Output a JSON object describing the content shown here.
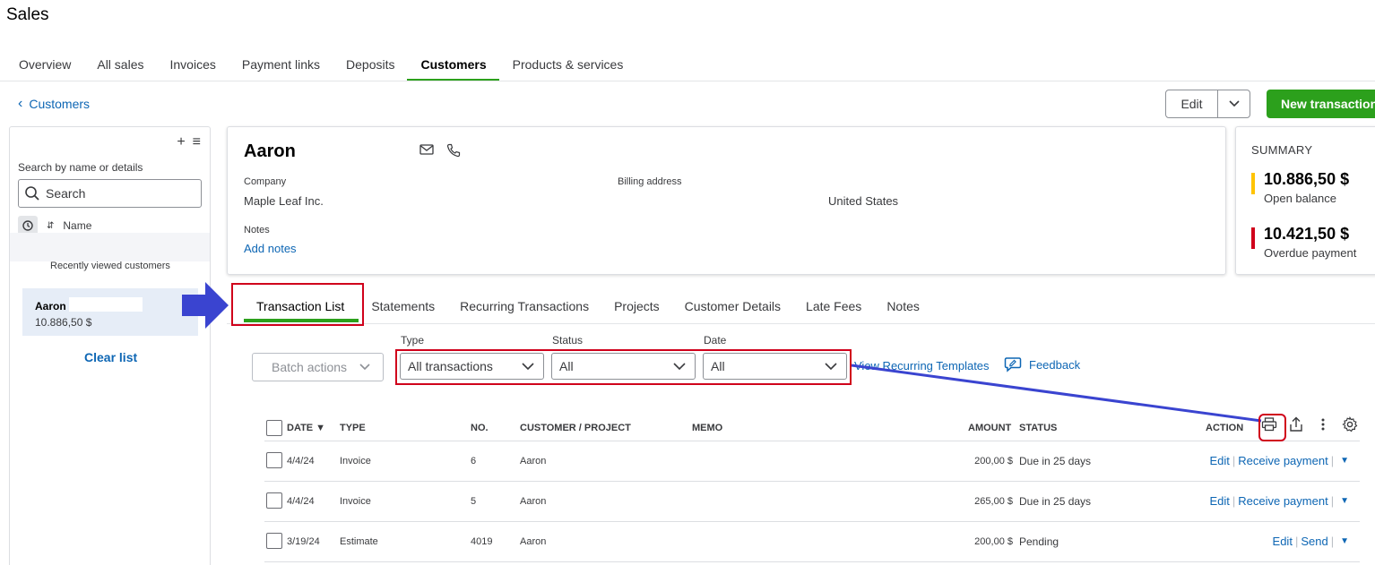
{
  "page": {
    "title": "Sales"
  },
  "top_tabs": [
    {
      "label": "Overview"
    },
    {
      "label": "All sales"
    },
    {
      "label": "Invoices"
    },
    {
      "label": "Payment links"
    },
    {
      "label": "Deposits"
    },
    {
      "label": "Customers"
    },
    {
      "label": "Products & services"
    }
  ],
  "nav": {
    "back_label": "Customers",
    "edit_label": "Edit",
    "new_transaction_label": "New transaction"
  },
  "sidebar": {
    "search_label": "Search by name or details",
    "search_placeholder": "Search",
    "sort_label": "Name",
    "recent_label": "Recently viewed customers",
    "customer": {
      "name": "Aaron",
      "balance": "10.886,50 $"
    },
    "clear_label": "Clear list"
  },
  "customer": {
    "name": "Aaron",
    "company_label": "Company",
    "company": "Maple Leaf Inc.",
    "billing_label": "Billing address",
    "billing_country": "United States",
    "notes_label": "Notes",
    "add_notes": "Add notes"
  },
  "summary": {
    "title": "SUMMARY",
    "open_balance": {
      "amount": "10.886,50 $",
      "label": "Open balance",
      "color": "#ffc400"
    },
    "overdue": {
      "amount": "10.421,50 $",
      "label": "Overdue payment",
      "color": "#d0011b"
    }
  },
  "sub_tabs": [
    {
      "label": "Transaction List"
    },
    {
      "label": "Statements"
    },
    {
      "label": "Recurring Transactions"
    },
    {
      "label": "Projects"
    },
    {
      "label": "Customer Details"
    },
    {
      "label": "Late Fees"
    },
    {
      "label": "Notes"
    }
  ],
  "filters": {
    "batch_label": "Batch actions",
    "type_label": "Type",
    "type_value": "All transactions",
    "status_label": "Status",
    "status_value": "All",
    "date_label": "Date",
    "date_value": "All",
    "view_recurring": "View Recurring Templates",
    "feedback": "Feedback"
  },
  "table": {
    "headers": {
      "date": "DATE ▼",
      "type": "TYPE",
      "no": "NO.",
      "customer": "CUSTOMER / PROJECT",
      "memo": "MEMO",
      "amount": "AMOUNT",
      "status": "STATUS",
      "action": "ACTION"
    },
    "rows": [
      {
        "date": "4/4/24",
        "type": "Invoice",
        "no": "6",
        "customer": "Aaron",
        "memo": "",
        "amount": "200,00 $",
        "status": "Due in 25 days",
        "action1": "Edit",
        "action2": "Receive payment"
      },
      {
        "date": "4/4/24",
        "type": "Invoice",
        "no": "5",
        "customer": "Aaron",
        "memo": "",
        "amount": "265,00 $",
        "status": "Due in 25 days",
        "action1": "Edit",
        "action2": "Receive payment"
      },
      {
        "date": "3/19/24",
        "type": "Estimate",
        "no": "4019",
        "customer": "Aaron",
        "memo": "",
        "amount": "200,00 $",
        "status": "Pending",
        "action1": "Edit",
        "action2": "Send"
      }
    ]
  },
  "colors": {
    "accent_green": "#2ca01c",
    "link_blue": "#0d66b4",
    "annotation_red": "#d0011b",
    "annotation_blue": "#3a44d0"
  }
}
